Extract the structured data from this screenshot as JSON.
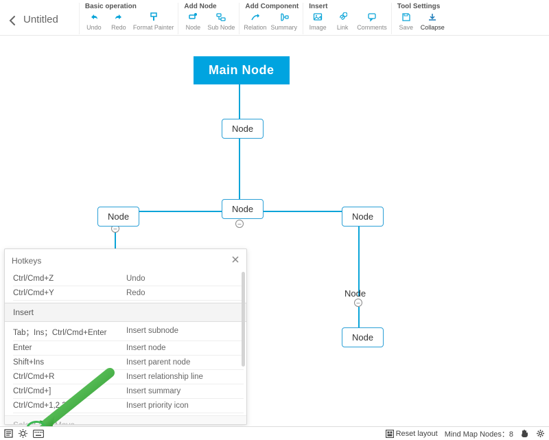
{
  "doc_title": "Untitled",
  "toolbar": {
    "groups": [
      {
        "label": "Basic operation",
        "buttons": [
          {
            "name": "undo-button",
            "icon": "undo",
            "label": "Undo"
          },
          {
            "name": "redo-button",
            "icon": "redo",
            "label": "Redo"
          },
          {
            "name": "format-painter-button",
            "icon": "brush",
            "label": "Format Painter"
          }
        ]
      },
      {
        "label": "Add Node",
        "buttons": [
          {
            "name": "add-node-button",
            "icon": "node",
            "label": "Node"
          },
          {
            "name": "add-subnode-button",
            "icon": "subnode",
            "label": "Sub Node"
          }
        ]
      },
      {
        "label": "Add Component",
        "buttons": [
          {
            "name": "relation-button",
            "icon": "relation",
            "label": "Relation"
          },
          {
            "name": "summary-button",
            "icon": "summary",
            "label": "Summary"
          }
        ]
      },
      {
        "label": "Insert",
        "buttons": [
          {
            "name": "insert-image-button",
            "icon": "image",
            "label": "Image"
          },
          {
            "name": "insert-link-button",
            "icon": "link",
            "label": "Link"
          },
          {
            "name": "insert-comment-button",
            "icon": "comment",
            "label": "Comments"
          }
        ]
      },
      {
        "label": "Tool Settings",
        "buttons": [
          {
            "name": "save-button",
            "icon": "save",
            "label": "Save"
          },
          {
            "name": "collapse-button",
            "icon": "collapse",
            "label": "Collapse",
            "dark": true
          }
        ]
      }
    ]
  },
  "nodes": {
    "main": "Main Node",
    "child": "Node"
  },
  "hotkeys": {
    "title": "Hotkeys",
    "top_rows": [
      {
        "key": "Ctrl/Cmd+Z",
        "desc": "Undo"
      },
      {
        "key": "Ctrl/Cmd+Y",
        "desc": "Redo"
      }
    ],
    "section_insert": "Insert",
    "insert_rows": [
      {
        "key": "Tab；Ins；Ctrl/Cmd+Enter",
        "desc": "Insert subnode"
      },
      {
        "key": "Enter",
        "desc": "Insert node"
      },
      {
        "key": "Shift+Ins",
        "desc": "Insert parent node"
      },
      {
        "key": "Ctrl/Cmd+R",
        "desc": "Insert relationship line"
      },
      {
        "key": "Ctrl/Cmd+]",
        "desc": "Insert summary"
      },
      {
        "key": "Ctrl/Cmd+1,2,3…",
        "desc": "Insert priority icon"
      }
    ],
    "section_move": "Select And Move"
  },
  "statusbar": {
    "reset": "Reset layout",
    "count_label": "Mind Map Nodes：",
    "count_value": "8"
  }
}
